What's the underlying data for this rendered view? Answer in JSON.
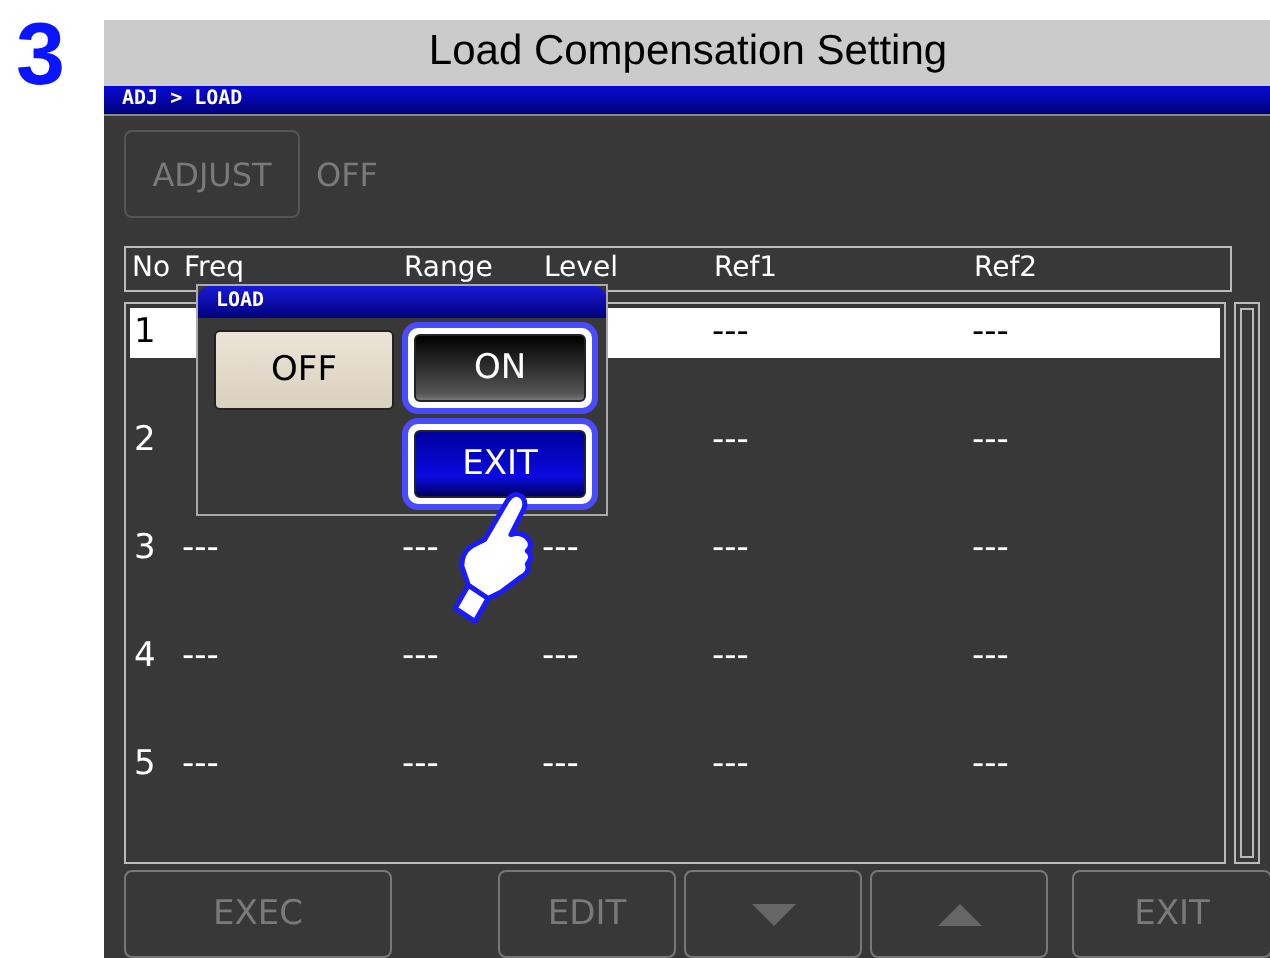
{
  "step": "3",
  "title": "Load Compensation Setting",
  "breadcrumb": "ADJ > LOAD",
  "adjust": {
    "label": "ADJUST",
    "value": "OFF",
    "disabled": true
  },
  "table": {
    "columns": [
      "No",
      "Freq",
      "Range",
      "Level",
      "Ref1",
      "Ref2"
    ],
    "rows": [
      {
        "selected": true,
        "cells": [
          "1",
          null,
          null,
          null,
          "---",
          "---"
        ]
      },
      {
        "selected": false,
        "cells": [
          "2",
          null,
          null,
          null,
          "---",
          "---"
        ]
      },
      {
        "selected": false,
        "cells": [
          "3",
          "---",
          "---",
          "---",
          "---",
          "---"
        ]
      },
      {
        "selected": false,
        "cells": [
          "4",
          "---",
          "---",
          "---",
          "---",
          "---"
        ]
      },
      {
        "selected": false,
        "cells": [
          "5",
          "---",
          "---",
          "---",
          "---",
          "---"
        ]
      }
    ]
  },
  "dialog": {
    "title": "LOAD",
    "options": [
      {
        "label": "OFF",
        "selected": false
      },
      {
        "label": "ON",
        "selected": true
      }
    ],
    "exit": "EXIT"
  },
  "buttons": [
    {
      "kind": "text",
      "label": "EXEC",
      "disabled": true
    },
    {
      "kind": "text",
      "label": "EDIT",
      "disabled": true
    },
    {
      "kind": "down",
      "disabled": true
    },
    {
      "kind": "up",
      "disabled": true
    },
    {
      "kind": "text",
      "label": "EXIT",
      "disabled": true
    }
  ]
}
